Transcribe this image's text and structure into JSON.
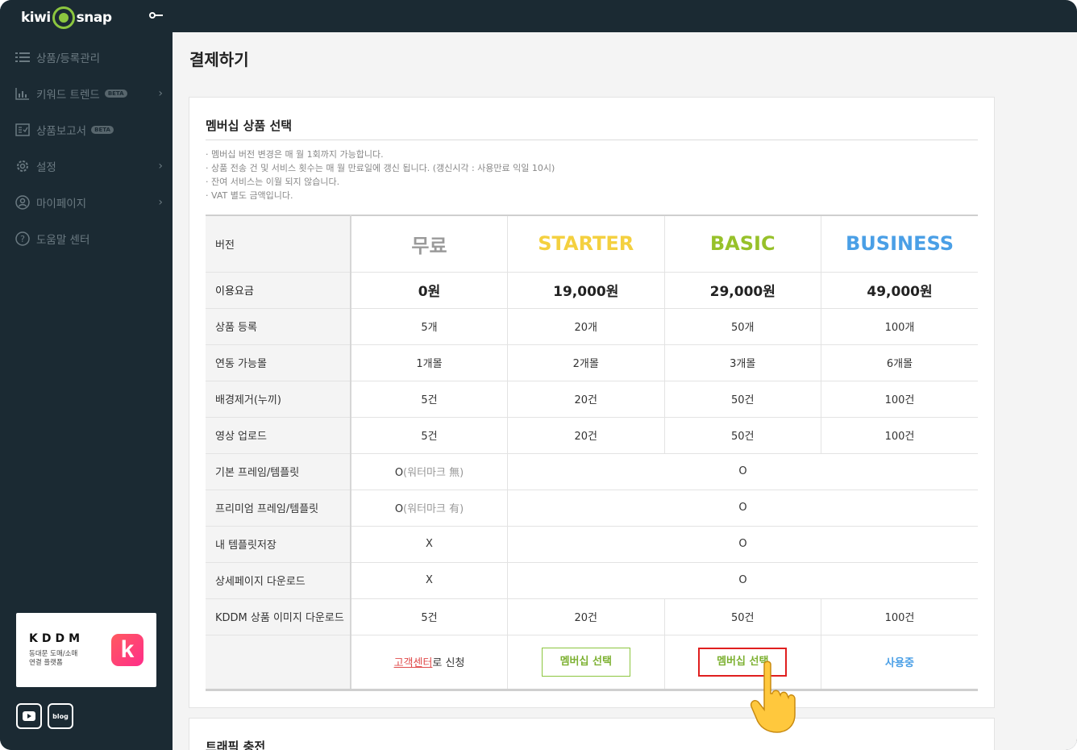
{
  "app": {
    "logo_left": "kiwi",
    "logo_right": "snap",
    "top_icon": "key-icon"
  },
  "sidebar": {
    "items": [
      {
        "label": "상품/등록관리",
        "icon": "list-icon",
        "beta": "",
        "chevron": false
      },
      {
        "label": "키워드 트렌드",
        "icon": "bar-chart-icon",
        "beta": "BETA",
        "chevron": true
      },
      {
        "label": "상품보고서",
        "icon": "report-icon",
        "beta": "BETA",
        "chevron": false
      },
      {
        "label": "설정",
        "icon": "gear-icon",
        "beta": "",
        "chevron": true
      },
      {
        "label": "마이페이지",
        "icon": "user-icon",
        "beta": "",
        "chevron": true
      },
      {
        "label": "도움말 센터",
        "icon": "help-icon",
        "beta": "",
        "chevron": false
      }
    ],
    "kddm": {
      "title": "KDDM",
      "sub": "동대문 도매/소매\n연결 플랫폼",
      "logo_letter": "k"
    },
    "social": {
      "youtube": "youtube-icon",
      "blog": "blog"
    }
  },
  "main": {
    "page_title": "결제하기",
    "panel": {
      "title": "멤버십 상품 선택",
      "notes": [
        "· 멤버십 버전 변경은 매 월 1회까지 가능합니다.",
        "· 상품 전송 건 및 서비스 횟수는 매 월 만료일에 갱신 됩니다. (갱신시각 : 사용만료 익일 10시)",
        "· 잔여 서비스는 이월 되지 않습니다.",
        "· VAT 별도 금액입니다."
      ]
    },
    "table": {
      "versions_label": "버전",
      "versions": [
        "무료",
        "STARTER",
        "BASIC",
        "BUSINESS"
      ],
      "fee_label": "이용요금",
      "fees": [
        "0원",
        "19,000원",
        "29,000원",
        "49,000원"
      ],
      "rows4": [
        {
          "label": "상품 등록",
          "values": [
            "5개",
            "20개",
            "50개",
            "100개"
          ]
        },
        {
          "label": "연동 가능몰",
          "values": [
            "1개몰",
            "2개몰",
            "3개몰",
            "6개몰"
          ]
        },
        {
          "label": "배경제거(누끼)",
          "values": [
            "5건",
            "20건",
            "50건",
            "100건"
          ]
        },
        {
          "label": "영상 업로드",
          "values": [
            "5건",
            "20건",
            "50건",
            "100건"
          ]
        }
      ],
      "rows2": [
        {
          "label": "기본 프레임/템플릿",
          "free_main": "O",
          "free_note": "(워터마크 無)",
          "paid": "O"
        },
        {
          "label": "프리미엄 프레임/템플릿",
          "free_main": "O",
          "free_note": "(워터마크 有)",
          "paid": "O"
        },
        {
          "label": "내 템플릿저장",
          "free_main": "X",
          "free_note": "",
          "paid": "O"
        },
        {
          "label": "상세페이지 다운로드",
          "free_main": "X",
          "free_note": "",
          "paid": "O"
        }
      ],
      "kddm_row": {
        "label": "KDDM 상품 이미지 다운로드",
        "values": [
          "5건",
          "20건",
          "50건",
          "100건"
        ]
      },
      "actions": {
        "cs_link": "고객센터",
        "cs_suffix": "로 신청",
        "starter_btn": "멤버십 선택",
        "basic_btn": "멤버십 선택",
        "business_status": "사용중"
      }
    },
    "panel2": {
      "title": "트래픽 충전"
    }
  },
  "colors": {
    "sidebar_bg": "#1b2a33",
    "accent_green": "#8cc63f",
    "business_blue": "#4a9fe6",
    "starter_yellow": "#f4d03f",
    "highlight_red": "#e01f1f"
  }
}
